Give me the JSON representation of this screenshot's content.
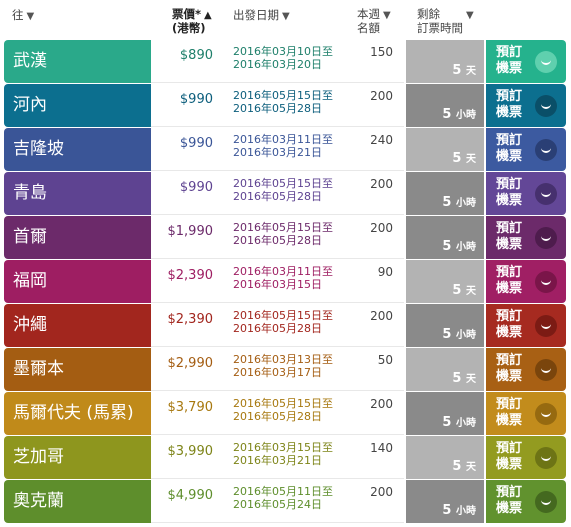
{
  "header": {
    "to": "往",
    "price": "票價*",
    "price_sub": "(港幣)",
    "depart": "出發日期",
    "quota": "本週",
    "quota2": "名額",
    "remain": "剩餘",
    "remain2": "訂票時間",
    "sort_down": "▼",
    "sort_up": "▲"
  },
  "book_label_1": "預訂",
  "book_label_2": "機票",
  "rows": [
    {
      "dest": "武漢",
      "price": "$890",
      "d1": "2016年03月10日至",
      "d2": "2016年03月20日",
      "quota": "150",
      "remain": "5",
      "unit": "天",
      "color": "#2aa98a",
      "bookc": "#25b28d",
      "smilec": "#5fd0ae",
      "textc": "#1e7f6a",
      "remainc": "#b3b3b3"
    },
    {
      "dest": "河內",
      "price": "$990",
      "d1": "2016年05月15日至",
      "d2": "2016年05月28日",
      "quota": "200",
      "remain": "5",
      "unit": "小時",
      "color": "#0c6f8f",
      "bookc": "#0c6f8f",
      "smilec": "#0a4f68",
      "textc": "#0c5e7c",
      "remainc": "#8a8a8a"
    },
    {
      "dest": "吉隆坡",
      "price": "$990",
      "d1": "2016年03月11日至",
      "d2": "2016年03月21日",
      "quota": "240",
      "remain": "5",
      "unit": "天",
      "color": "#3a5597",
      "bookc": "#3c5aa0",
      "smilec": "#2a3f75",
      "textc": "#3a5597",
      "remainc": "#b3b3b3"
    },
    {
      "dest": "青島",
      "price": "$990",
      "d1": "2016年05月15日至",
      "d2": "2016年05月28日",
      "quota": "200",
      "remain": "5",
      "unit": "小時",
      "color": "#5e4391",
      "bookc": "#634797",
      "smilec": "#46306e",
      "textc": "#5e4391",
      "remainc": "#8a8a8a"
    },
    {
      "dest": "首爾",
      "price": "$1,990",
      "d1": "2016年05月15日至",
      "d2": "2016年05月28日",
      "quota": "200",
      "remain": "5",
      "unit": "小時",
      "color": "#6c2a6a",
      "bookc": "#6c2a6a",
      "smilec": "#4e1c4d",
      "textc": "#6c2a6a",
      "remainc": "#8a8a8a"
    },
    {
      "dest": "福岡",
      "price": "$2,390",
      "d1": "2016年03月11日至",
      "d2": "2016年03月15日",
      "quota": "90",
      "remain": "5",
      "unit": "天",
      "color": "#9e1e62",
      "bookc": "#a01f64",
      "smilec": "#7a1549",
      "textc": "#9e1e62",
      "remainc": "#b3b3b3"
    },
    {
      "dest": "沖繩",
      "price": "$2,390",
      "d1": "2016年05月15日至",
      "d2": "2016年05月28日",
      "quota": "200",
      "remain": "5",
      "unit": "小時",
      "color": "#a2261e",
      "bookc": "#a62a20",
      "smilec": "#7c1b14",
      "textc": "#a2261e",
      "remainc": "#8a8a8a"
    },
    {
      "dest": "墨爾本",
      "price": "$2,990",
      "d1": "2016年03月13日至",
      "d2": "2016年03月17日",
      "quota": "50",
      "remain": "5",
      "unit": "天",
      "color": "#a45d12",
      "bookc": "#a86014",
      "smilec": "#7a450c",
      "textc": "#a45d12",
      "remainc": "#b3b3b3"
    },
    {
      "dest": "馬爾代夫 (馬累)",
      "price": "$3,790",
      "d1": "2016年05月15日至",
      "d2": "2016年05月28日",
      "quota": "200",
      "remain": "5",
      "unit": "小時",
      "color": "#c08a1a",
      "bookc": "#c28c1c",
      "smilec": "#966a10",
      "textc": "#a7780f",
      "remainc": "#8a8a8a"
    },
    {
      "dest": "芝加哥",
      "price": "$3,990",
      "d1": "2016年03月15日至",
      "d2": "2016年03月21日",
      "quota": "140",
      "remain": "5",
      "unit": "天",
      "color": "#8e961e",
      "bookc": "#939b20",
      "smilec": "#6d7415",
      "textc": "#7d8418",
      "remainc": "#b3b3b3"
    },
    {
      "dest": "奧克蘭",
      "price": "$4,990",
      "d1": "2016年05月11日至",
      "d2": "2016年05月24日",
      "quota": "200",
      "remain": "5",
      "unit": "小時",
      "color": "#5e8e2c",
      "bookc": "#61922e",
      "smilec": "#44691f",
      "textc": "#5e8e2c",
      "remainc": "#8a8a8a"
    }
  ]
}
